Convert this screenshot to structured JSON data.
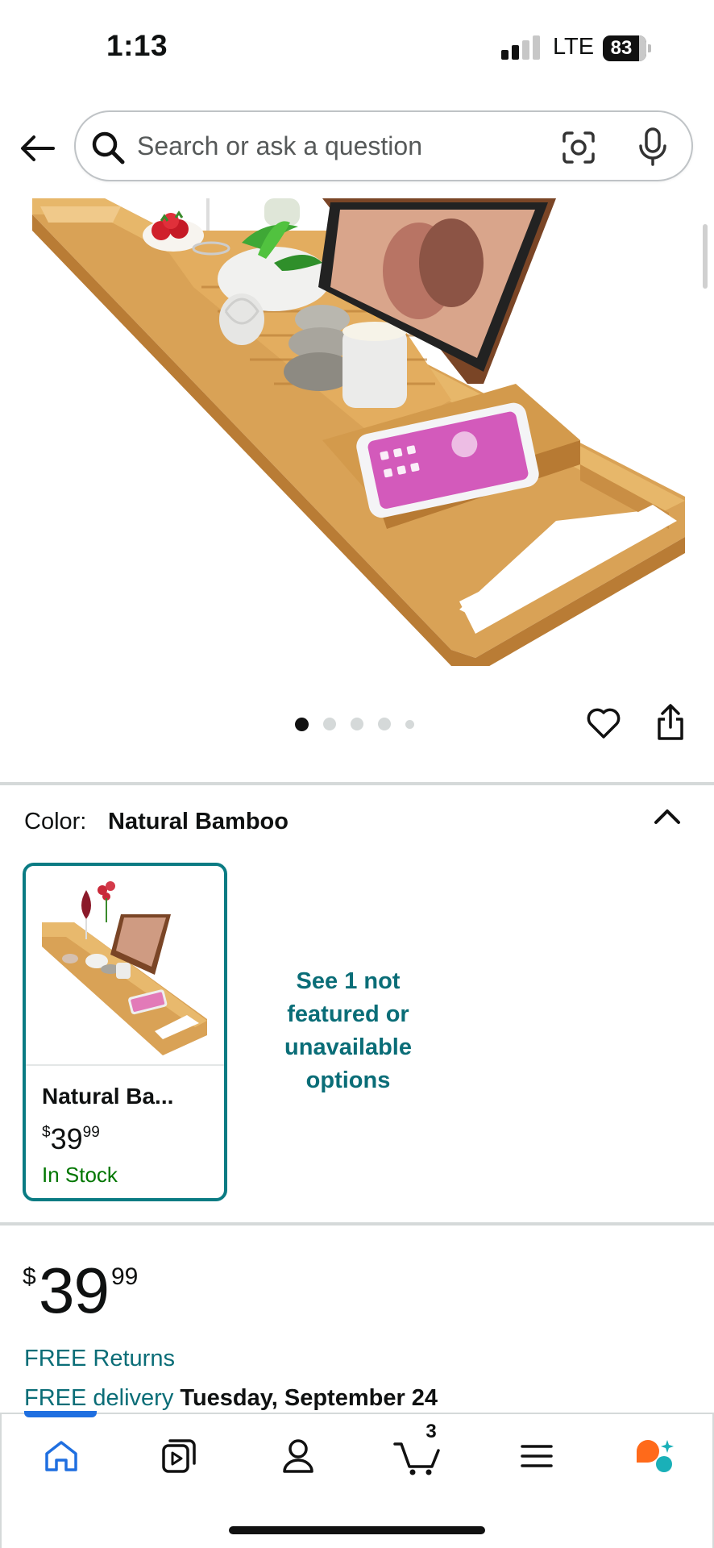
{
  "status_bar": {
    "time": "1:13",
    "network": "LTE",
    "battery": "83",
    "battery_level": 0.83,
    "signal_bars_filled": 2,
    "signal_bars_total": 4
  },
  "search": {
    "placeholder": "Search or ask a question",
    "value": ""
  },
  "icons": {
    "back": "arrow-left-icon",
    "search": "magnifier-icon",
    "camera": "camera-lens-icon",
    "mic": "microphone-icon",
    "wishlist": "heart-icon",
    "share": "share-icon",
    "collapse": "chevron-up-icon",
    "nav": [
      "home-icon",
      "video-icon",
      "user-icon",
      "cart-icon",
      "menu-icon",
      "ai-assistant-icon"
    ]
  },
  "gallery": {
    "image_count": 5,
    "active_index": 0
  },
  "color_selector": {
    "label": "Color:",
    "selected": "Natural Bamboo",
    "swatch": {
      "name": "Natural Ba...",
      "currency": "$",
      "price_whole": "39",
      "price_fraction": "99",
      "stock": "In Stock"
    },
    "more_options": "See 1 not featured or unavailable options"
  },
  "price": {
    "currency": "$",
    "whole": "39",
    "fraction": "99"
  },
  "shipping": {
    "returns": "FREE Returns",
    "delivery_link": "FREE delivery",
    "delivery_date": "Tuesday, September 24"
  },
  "bottom_nav": {
    "active": "home",
    "cart_count": "3"
  },
  "colors": {
    "link": "#0a6d77",
    "swatch_border": "#0a7b83",
    "in_stock": "#007600",
    "nav_active": "#1f6fe0",
    "ai_orange": "#ff6a1a",
    "ai_teal": "#1ab0b8"
  }
}
